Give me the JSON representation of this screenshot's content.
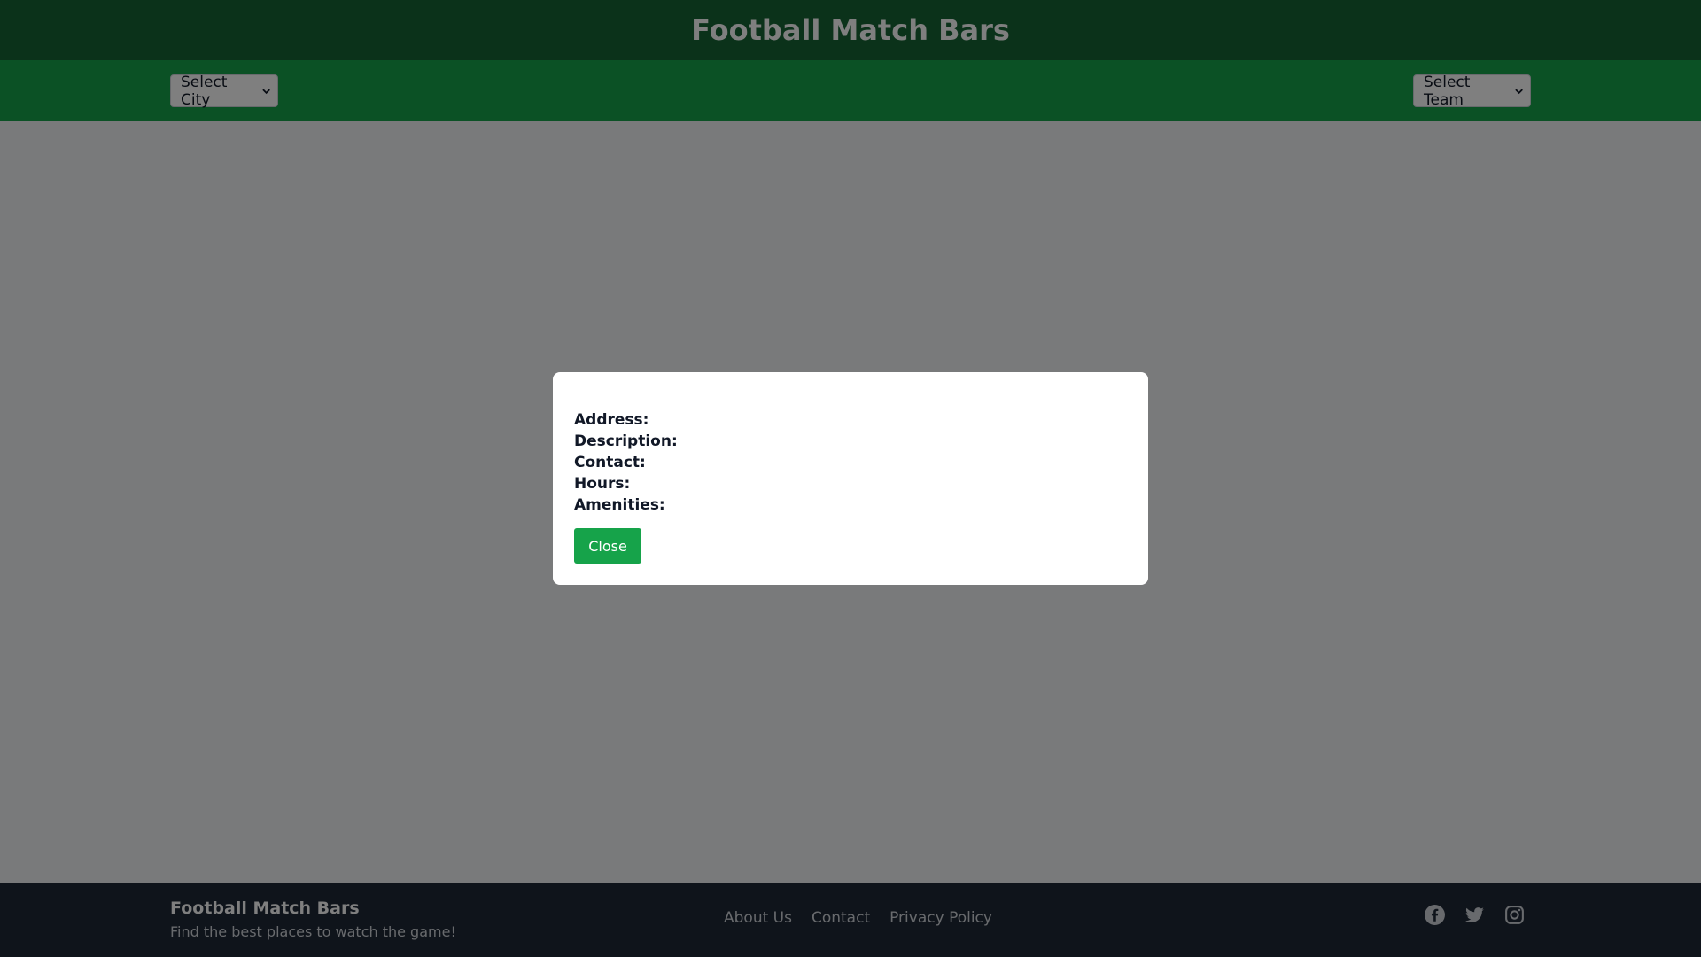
{
  "header": {
    "title": "Football Match Bars"
  },
  "filters": {
    "city_placeholder": "Select City",
    "team_placeholder": "Select Team"
  },
  "modal": {
    "name": "",
    "address_label": "Address:",
    "address_value": "",
    "description_label": "Description:",
    "description_value": "",
    "contact_label": "Contact:",
    "contact_value": "",
    "hours_label": "Hours:",
    "hours_value": "",
    "amenities_label": "Amenities:",
    "amenities_value": "",
    "close_label": "Close"
  },
  "footer": {
    "brand": "Football Match Bars",
    "tagline": "Find the best places to watch the game!",
    "links": {
      "about": "About Us",
      "contact": "Contact",
      "privacy": "Privacy Policy"
    },
    "social_icons": [
      "facebook-icon",
      "twitter-icon",
      "instagram-icon"
    ]
  },
  "colors": {
    "header_bg": "#166534",
    "filter_bar_bg": "#16a34a",
    "footer_bg": "#1f2937",
    "accent": "#16a34a"
  }
}
